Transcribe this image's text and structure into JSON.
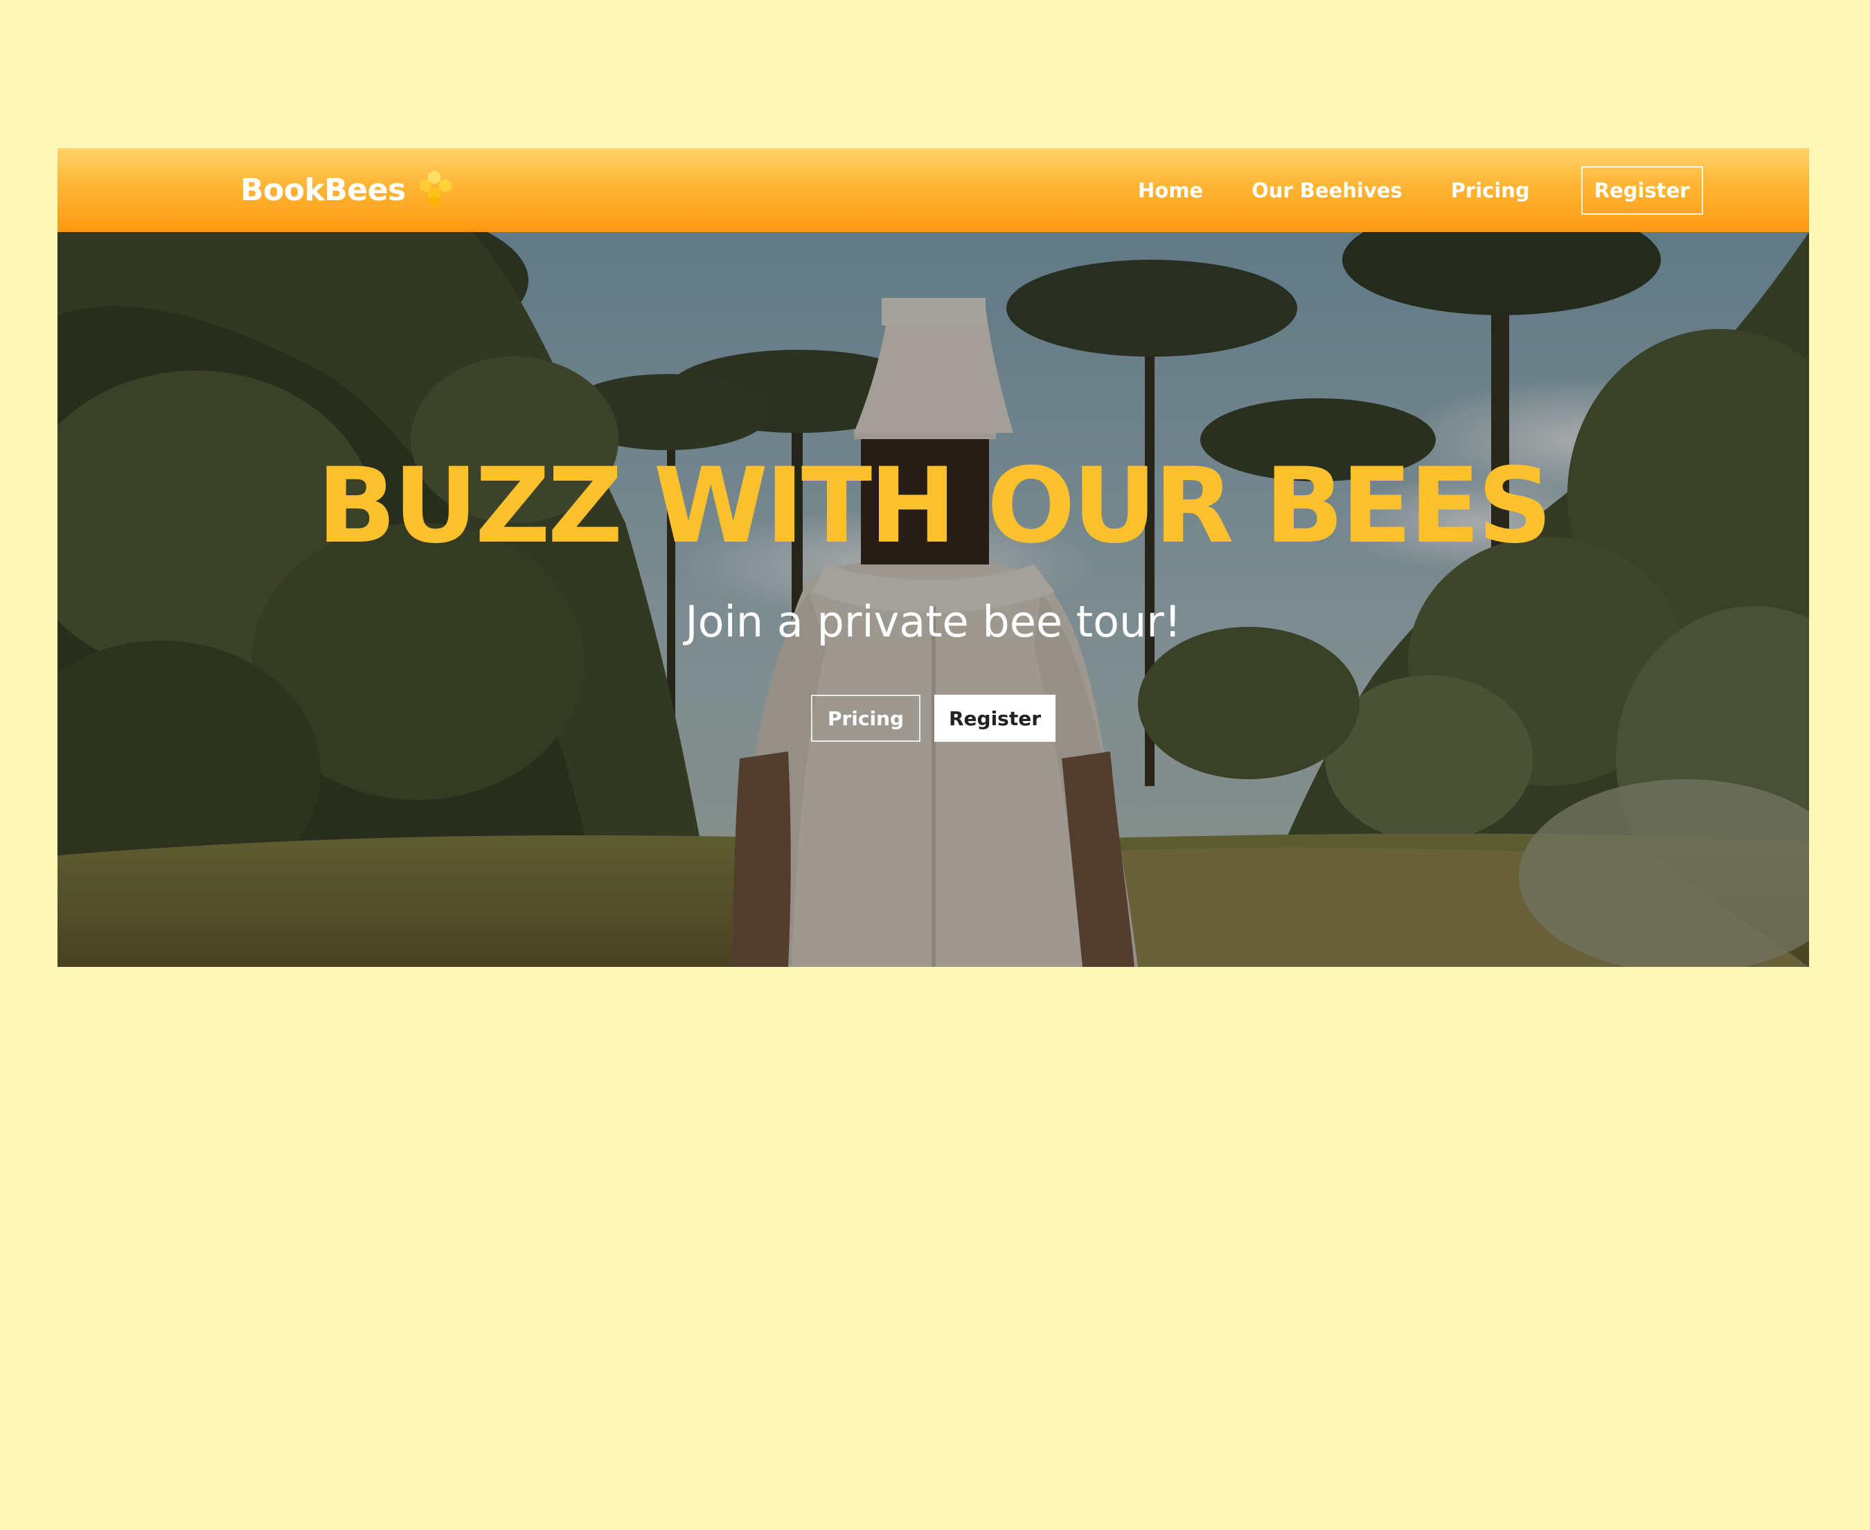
{
  "navbar": {
    "brand": "BookBees",
    "links": {
      "home": "Home",
      "beehives": "Our Beehives",
      "pricing": "Pricing"
    },
    "register": "Register"
  },
  "hero": {
    "title": "BUZZ WITH OUR BEES",
    "subtitle": "Join a private bee tour!",
    "buttons": {
      "pricing": "Pricing",
      "register": "Register"
    },
    "image": "beekeeper in protective suit standing in a forest"
  },
  "colors": {
    "page_background": "#fff7b8",
    "navbar_top": "#ffd36a",
    "navbar_bottom": "#ff9a12",
    "title_yellow": "#fbc02d",
    "white": "#ffffff"
  }
}
